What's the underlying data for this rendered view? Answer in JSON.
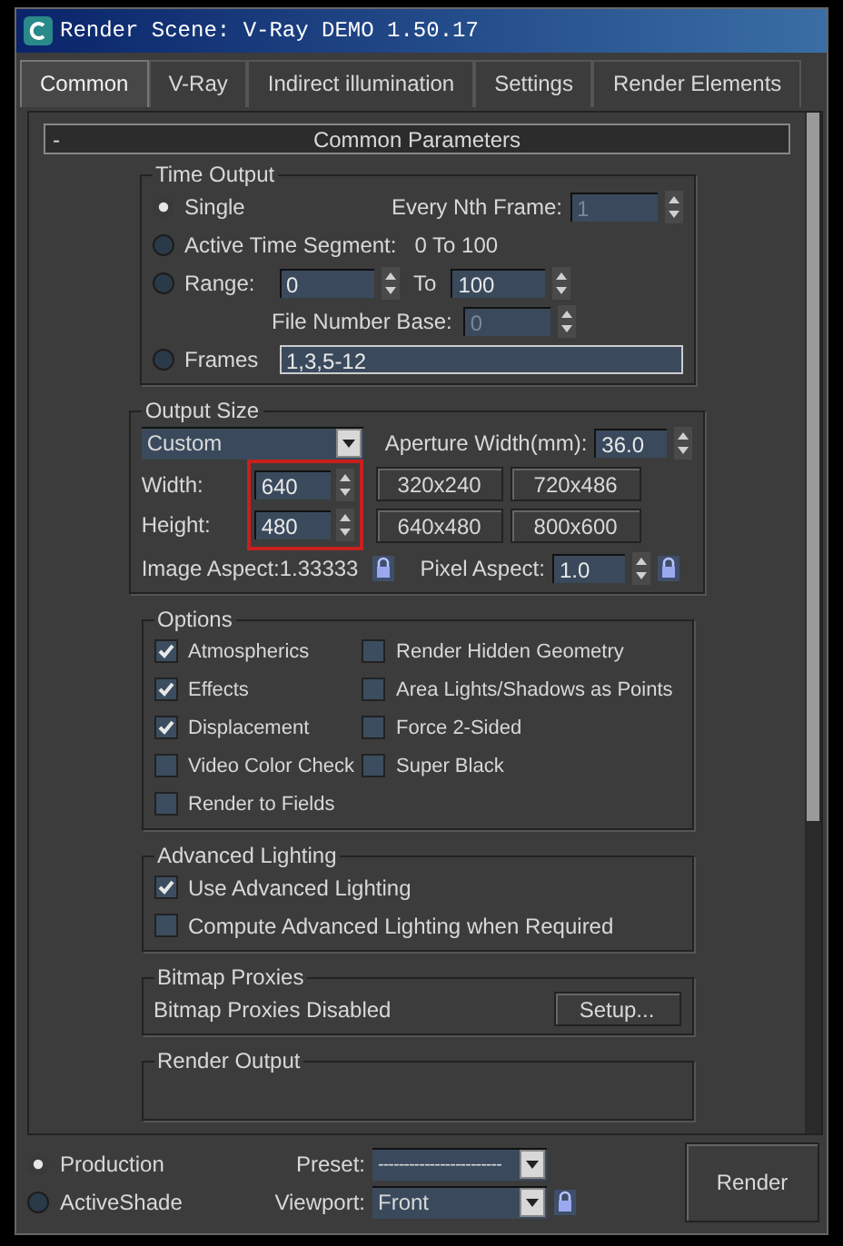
{
  "window": {
    "title": "Render Scene: V-Ray DEMO 1.50.17"
  },
  "tabs": [
    {
      "label": "Common",
      "selected": true
    },
    {
      "label": "V-Ray",
      "selected": false
    },
    {
      "label": "Indirect illumination",
      "selected": false
    },
    {
      "label": "Settings",
      "selected": false
    },
    {
      "label": "Render Elements",
      "selected": false
    }
  ],
  "rollout": {
    "toggle": "-",
    "title": "Common Parameters"
  },
  "time_output": {
    "title": "Time Output",
    "modes": [
      {
        "label": "Single",
        "selected": true
      },
      {
        "label": "Active Time Segment:",
        "selected": false
      },
      {
        "label": "Range:",
        "selected": false
      },
      {
        "label": "Frames",
        "selected": false
      }
    ],
    "every_nth_frame": {
      "label": "Every Nth Frame:",
      "value": "1",
      "disabled": true
    },
    "active_segment": "0 To 100",
    "range": {
      "from": "0",
      "to_label": "To",
      "to": "100"
    },
    "file_number_base": {
      "label": "File Number Base:",
      "value": "0",
      "disabled": true
    },
    "frames": "1,3,5-12"
  },
  "output_size": {
    "title": "Output Size",
    "preset": "Custom",
    "aperture": {
      "label": "Aperture Width(mm):",
      "value": "36.0"
    },
    "width": {
      "label": "Width:",
      "value": "640"
    },
    "height": {
      "label": "Height:",
      "value": "480"
    },
    "highlighted": true,
    "sizes": [
      "320x240",
      "720x486",
      "640x480",
      "800x600"
    ],
    "image_aspect": "Image Aspect:1.33333",
    "pixel_aspect": {
      "label": "Pixel Aspect:",
      "value": "1.0"
    }
  },
  "options": {
    "title": "Options",
    "columns": [
      [
        {
          "label": "Atmospherics",
          "checked": true
        },
        {
          "label": "Effects",
          "checked": true
        },
        {
          "label": "Displacement",
          "checked": true
        },
        {
          "label": "Video Color Check",
          "checked": false
        },
        {
          "label": "Render to Fields",
          "checked": false
        }
      ],
      [
        {
          "label": "Render Hidden Geometry",
          "checked": false
        },
        {
          "label": "Area Lights/Shadows as Points",
          "checked": false
        },
        {
          "label": "Force 2-Sided",
          "checked": false
        },
        {
          "label": "Super Black",
          "checked": false
        }
      ]
    ]
  },
  "advanced_lighting": {
    "title": "Advanced Lighting",
    "items": [
      {
        "label": "Use Advanced Lighting",
        "checked": true
      },
      {
        "label": "Compute Advanced Lighting when Required",
        "checked": false
      }
    ]
  },
  "bitmap_proxies": {
    "title": "Bitmap Proxies",
    "status": "Bitmap Proxies Disabled",
    "button": "Setup..."
  },
  "render_output": {
    "title": "Render Output"
  },
  "bottom": {
    "modes": [
      {
        "label": "Production",
        "selected": true
      },
      {
        "label": "ActiveShade",
        "selected": false
      }
    ],
    "preset": {
      "label": "Preset:",
      "value": "------------------------"
    },
    "viewport": {
      "label": "Viewport:",
      "value": "Front"
    },
    "render_button": "Render"
  }
}
